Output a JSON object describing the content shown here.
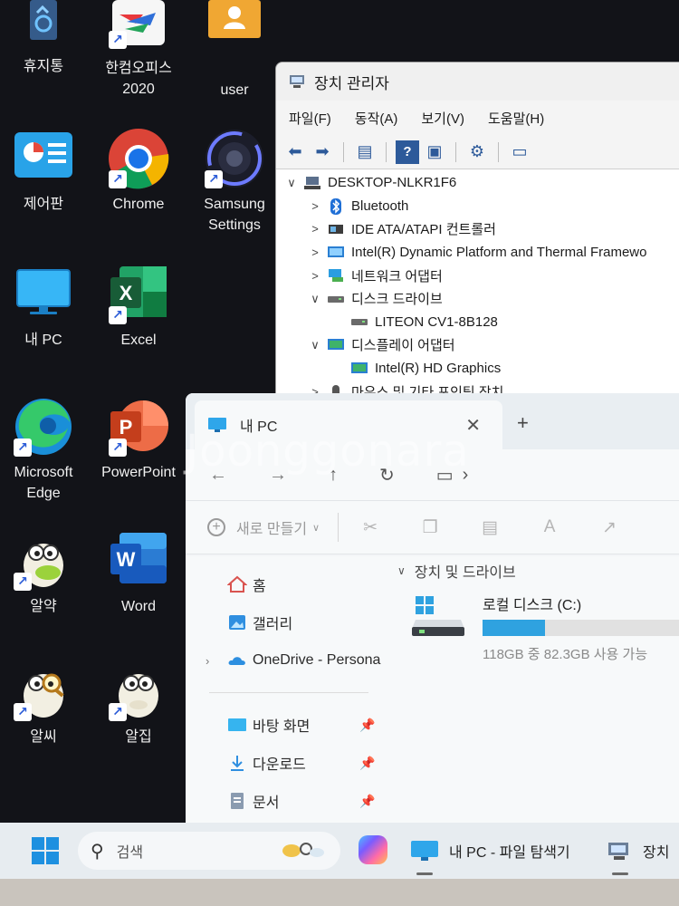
{
  "desktop": {
    "icons": [
      {
        "label": "휴지통"
      },
      {
        "label": "한컴오피스\n2020"
      },
      {
        "label": "user"
      },
      {
        "label": "제어판"
      },
      {
        "label": "Chrome"
      },
      {
        "label": "Samsung\nSettings"
      },
      {
        "label": "내 PC"
      },
      {
        "label": "Excel"
      },
      {
        "label": "Microsoft\nEdge"
      },
      {
        "label": "PowerPoint"
      },
      {
        "label": "알약"
      },
      {
        "label": "Word"
      },
      {
        "label": "알씨"
      },
      {
        "label": "알집"
      }
    ]
  },
  "device_manager": {
    "title": "장치 관리자",
    "menu": [
      "파일(F)",
      "동작(A)",
      "보기(V)",
      "도움말(H)"
    ],
    "tree": [
      {
        "label": "DESKTOP-NLKR1F6",
        "arrow": "∨"
      },
      {
        "label": "Bluetooth",
        "arrow": ">"
      },
      {
        "label": "IDE ATA/ATAPI 컨트롤러",
        "arrow": ">"
      },
      {
        "label": "Intel(R) Dynamic Platform and Thermal Framewo",
        "arrow": ">"
      },
      {
        "label": "네트워크 어댑터",
        "arrow": ">"
      },
      {
        "label": "디스크 드라이브",
        "arrow": "∨"
      },
      {
        "label": "LITEON CV1-8B128",
        "arrow": ""
      },
      {
        "label": "디스플레이 어댑터",
        "arrow": "∨"
      },
      {
        "label": "Intel(R) HD Graphics",
        "arrow": ""
      },
      {
        "label": "마우스 및 기타 포인팅 장치",
        "arrow": ">"
      }
    ]
  },
  "explorer": {
    "tab_title": "내 PC",
    "tab_close": "✕",
    "new_tab": "+",
    "new_button": "새로 만들기",
    "nav": [
      {
        "label": "홈"
      },
      {
        "label": "갤러리"
      },
      {
        "label": "OneDrive - Persona"
      },
      {
        "label": "바탕 화면"
      },
      {
        "label": "다운로드"
      },
      {
        "label": "문서"
      }
    ],
    "section": "장치 및 드라이브",
    "drive": {
      "name": "로컬 디스크 (C:)",
      "used_fraction": 0.3,
      "size_text": "118GB 중 82.3GB 사용 가능"
    }
  },
  "watermark": "Joonggonara",
  "taskbar": {
    "search_placeholder": "검색",
    "app_explorer": "내 PC - 파일 탐색기",
    "app_devmgr": "장치"
  },
  "colors": {
    "accent": "#2fa2e0",
    "taskbar": "#e7ecf0",
    "desktop": "#121318"
  }
}
